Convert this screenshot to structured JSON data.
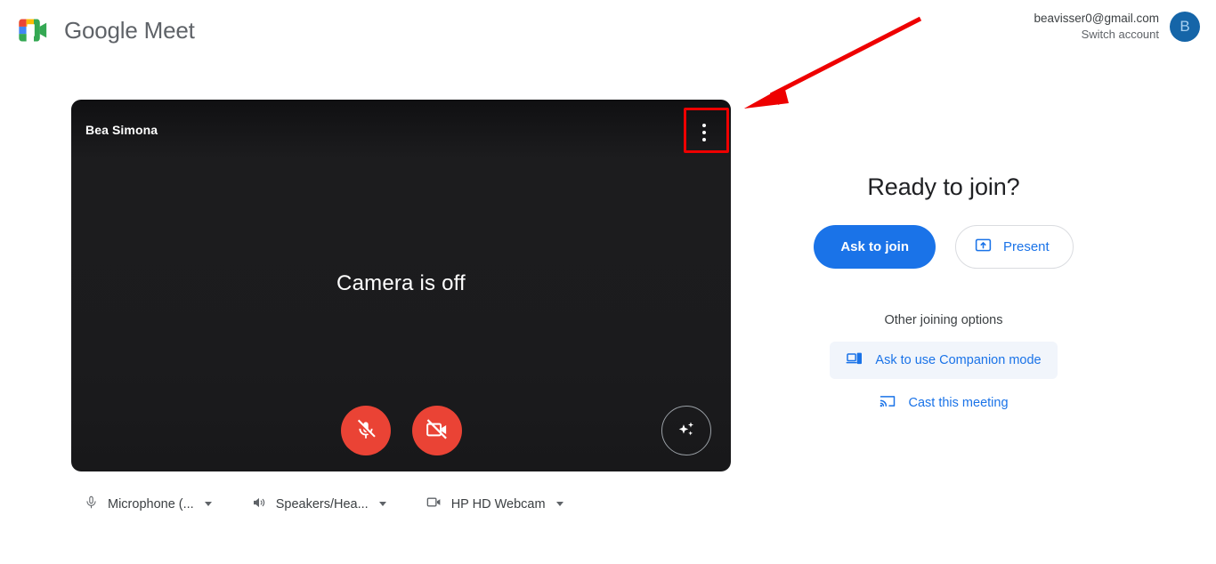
{
  "header": {
    "brand_google": "Google",
    "brand_product": "Meet",
    "logo_icon": "google-meet-logo-icon",
    "account_email": "beavisser0@gmail.com",
    "switch_account_label": "Switch account",
    "avatar_initial": "B",
    "avatar_color": "#1565a8"
  },
  "preview": {
    "self_name": "Bea Simona",
    "camera_status": "Camera is off",
    "more_options_icon": "more-vert-icon",
    "mic_button": {
      "icon": "microphone-muted-icon",
      "state": "muted",
      "color": "#ea4335"
    },
    "camera_button": {
      "icon": "camera-muted-icon",
      "state": "muted",
      "color": "#ea4335"
    },
    "effects_button": {
      "icon": "sparkle-effects-icon"
    }
  },
  "devices": [
    {
      "icon": "microphone-icon",
      "label": "Microphone (...",
      "caret": "chevron-down-icon"
    },
    {
      "icon": "speaker-icon",
      "label": "Speakers/Hea...",
      "caret": "chevron-down-icon"
    },
    {
      "icon": "video-camera-icon",
      "label": "HP HD Webcam",
      "caret": "chevron-down-icon"
    }
  ],
  "join": {
    "title": "Ready to join?",
    "ask_to_join_label": "Ask to join",
    "present_label": "Present",
    "present_icon": "present-screen-icon",
    "other_options_title": "Other joining options",
    "options": [
      {
        "icon": "companion-devices-icon",
        "label": "Ask to use Companion mode",
        "hovered": true
      },
      {
        "icon": "cast-icon",
        "label": "Cast this meeting",
        "hovered": false
      }
    ]
  },
  "annotation": {
    "arrow_color": "#ee0000",
    "highlight_color": "#ee0000",
    "highlight_target": "more-options-button"
  }
}
